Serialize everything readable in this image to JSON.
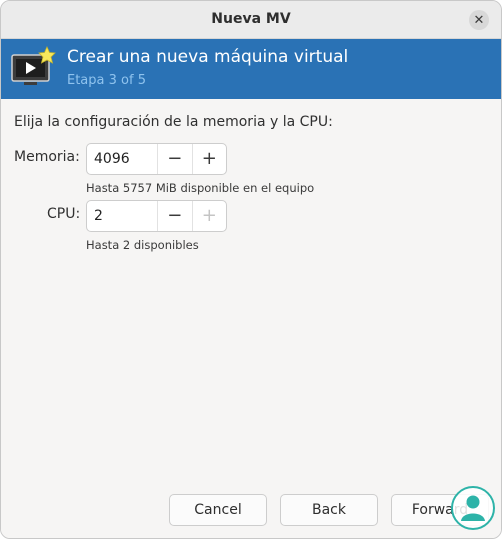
{
  "window": {
    "title": "Nueva MV",
    "close_glyph": "✕"
  },
  "header": {
    "title": "Crear una nueva máquina virtual",
    "step": "Etapa 3 of 5",
    "icon": "monitor-play-icon",
    "background_color": "#2a72b5"
  },
  "content": {
    "instruction": "Elija la configuración de la memoria y la CPU:",
    "memory": {
      "label": "Memoria:",
      "value": "4096",
      "hint": "Hasta 5757 MiB disponible en el equipo",
      "decrement_glyph": "−",
      "increment_glyph": "+"
    },
    "cpu": {
      "label": "CPU:",
      "value": "2",
      "hint": "Hasta 2 disponibles",
      "decrement_glyph": "−",
      "increment_glyph": "+"
    }
  },
  "buttons": {
    "cancel": "Cancel",
    "back": "Back",
    "forward": "Forward"
  },
  "watermark": {
    "icon": "user-watermark-icon"
  }
}
